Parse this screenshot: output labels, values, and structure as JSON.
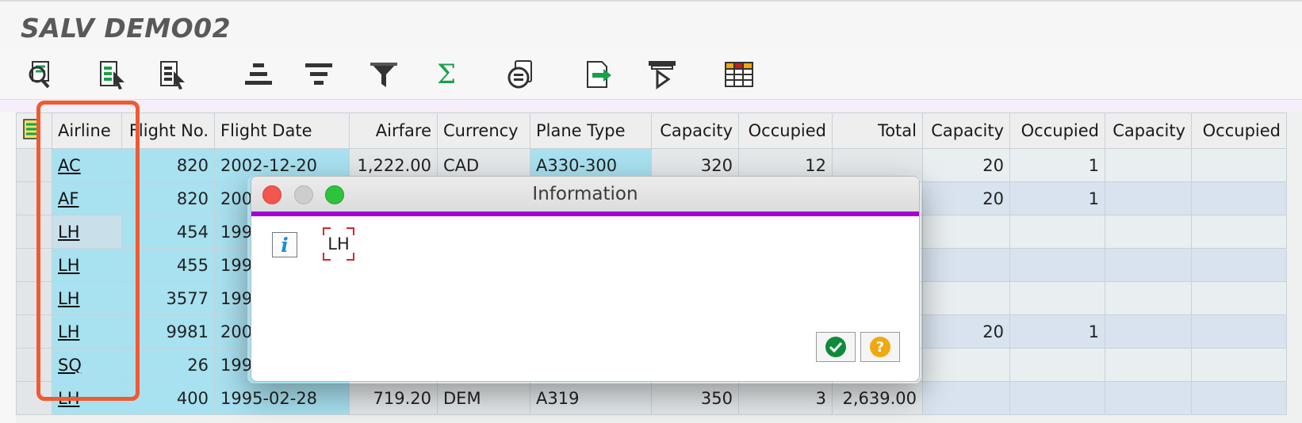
{
  "app": {
    "title": "SALV DEMO02"
  },
  "toolbar": {
    "buttons": [
      {
        "name": "details-icon"
      },
      {
        "name": "sort-ascending-icon"
      },
      {
        "name": "sort-descending-icon"
      },
      {
        "name": "center-align-icon"
      },
      {
        "name": "filter-lines-icon"
      },
      {
        "name": "filter-icon"
      },
      {
        "name": "sum-icon"
      },
      {
        "name": "print-preview-icon"
      },
      {
        "name": "export-icon"
      },
      {
        "name": "layout-icon"
      },
      {
        "name": "grid-view-icon"
      }
    ],
    "sum_glyph": "Σ"
  },
  "table": {
    "columns": [
      "Airline",
      "Flight No.",
      "Flight Date",
      "Airfare",
      "Currency",
      "Plane Type",
      "Capacity",
      "Occupied",
      "Total",
      "Capacity",
      "Occupied",
      "Capacity",
      "Occupied"
    ],
    "rows": [
      {
        "airline": "AC",
        "flight_no": "820",
        "flight_date": "2002-12-20",
        "airfare": "1,222.00",
        "currency": "CAD",
        "plane_type": "A330-300",
        "capacity": "320",
        "occupied": "12",
        "total": "",
        "capacity2": "20",
        "occupied2": "1",
        "capacity3": "",
        "occupied3": ""
      },
      {
        "airline": "AF",
        "flight_no": "820",
        "flight_date": "200",
        "airfare": "",
        "currency": "",
        "plane_type": "",
        "capacity": "",
        "occupied": "",
        "total": "",
        "capacity2": "20",
        "occupied2": "1",
        "capacity3": "",
        "occupied3": ""
      },
      {
        "airline": "LH",
        "flight_no": "454",
        "flight_date": "199",
        "airfare": "",
        "currency": "",
        "plane_type": "",
        "capacity": "",
        "occupied": "",
        "total": "",
        "capacity2": "",
        "occupied2": "",
        "capacity3": "",
        "occupied3": ""
      },
      {
        "airline": "LH",
        "flight_no": "455",
        "flight_date": "199",
        "airfare": "",
        "currency": "",
        "plane_type": "",
        "capacity": "",
        "occupied": "",
        "total": "",
        "capacity2": "",
        "occupied2": "",
        "capacity3": "",
        "occupied3": ""
      },
      {
        "airline": "LH",
        "flight_no": "3577",
        "flight_date": "199",
        "airfare": "",
        "currency": "",
        "plane_type": "",
        "capacity": "",
        "occupied": "",
        "total": "",
        "capacity2": "",
        "occupied2": "",
        "capacity3": "",
        "occupied3": ""
      },
      {
        "airline": "LH",
        "flight_no": "9981",
        "flight_date": "200",
        "airfare": "",
        "currency": "",
        "plane_type": "",
        "capacity": "",
        "occupied": "",
        "total": "",
        "capacity2": "20",
        "occupied2": "1",
        "capacity3": "",
        "occupied3": ""
      },
      {
        "airline": "SQ",
        "flight_no": "26",
        "flight_date": "199",
        "airfare": "",
        "currency": "",
        "plane_type": "",
        "capacity": "",
        "occupied": "",
        "total": "",
        "capacity2": "",
        "occupied2": "",
        "capacity3": "",
        "occupied3": ""
      },
      {
        "airline": "LH",
        "flight_no": "400",
        "flight_date": "1995-02-28",
        "airfare": "719.20",
        "currency": "DEM",
        "plane_type": "A319",
        "capacity": "350",
        "occupied": "3",
        "total": "2,639.00",
        "capacity2": "",
        "occupied2": "",
        "capacity3": "",
        "occupied3": ""
      }
    ]
  },
  "dialog": {
    "title": "Information",
    "info_glyph": "i",
    "message": "LH",
    "help_glyph": "?"
  },
  "colors": {
    "highlight_box": "#f05a32",
    "dialog_accent": "#a300d6",
    "key_column": "#a8e1f0"
  }
}
